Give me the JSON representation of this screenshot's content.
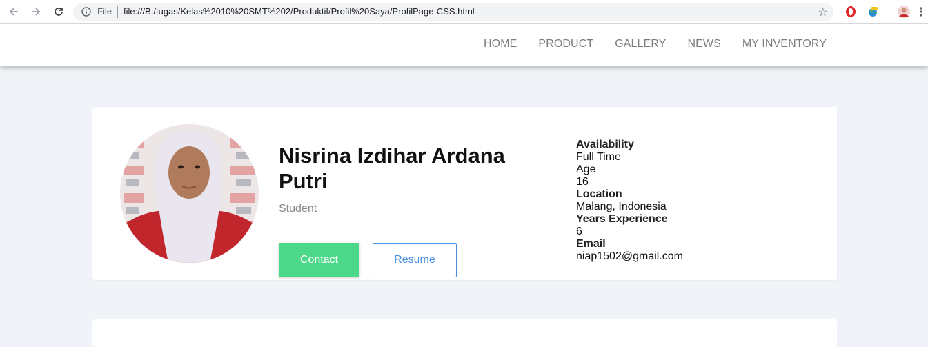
{
  "browser": {
    "scheme_label": "File",
    "url": "file:///B:/tugas/Kelas%2010%20SMT%202/Produktif/Profil%20Saya/ProfilPage-CSS.html"
  },
  "nav": {
    "links": [
      "HOME",
      "PRODUCT",
      "GALLERY",
      "NEWS",
      "MY INVENTORY"
    ]
  },
  "profile": {
    "name": "Nisrina Izdihar Ardana Putri",
    "role": "Student",
    "contact_label": "Contact",
    "resume_label": "Resume"
  },
  "info": [
    {
      "label": "Availability",
      "value": "Full Time",
      "label_bold": true
    },
    {
      "label": "Age",
      "value": "16",
      "label_bold": false
    },
    {
      "label": "Location",
      "value": "Malang, Indonesia",
      "label_bold": true
    },
    {
      "label": "Years Experience",
      "value": "6",
      "label_bold": true
    },
    {
      "label": "Email",
      "value": "niap1502@gmail.com",
      "label_bold": true
    }
  ],
  "colors": {
    "accent_green": "#4cd889",
    "accent_blue": "#4a90e2",
    "page_bg": "#f0f3f7"
  }
}
